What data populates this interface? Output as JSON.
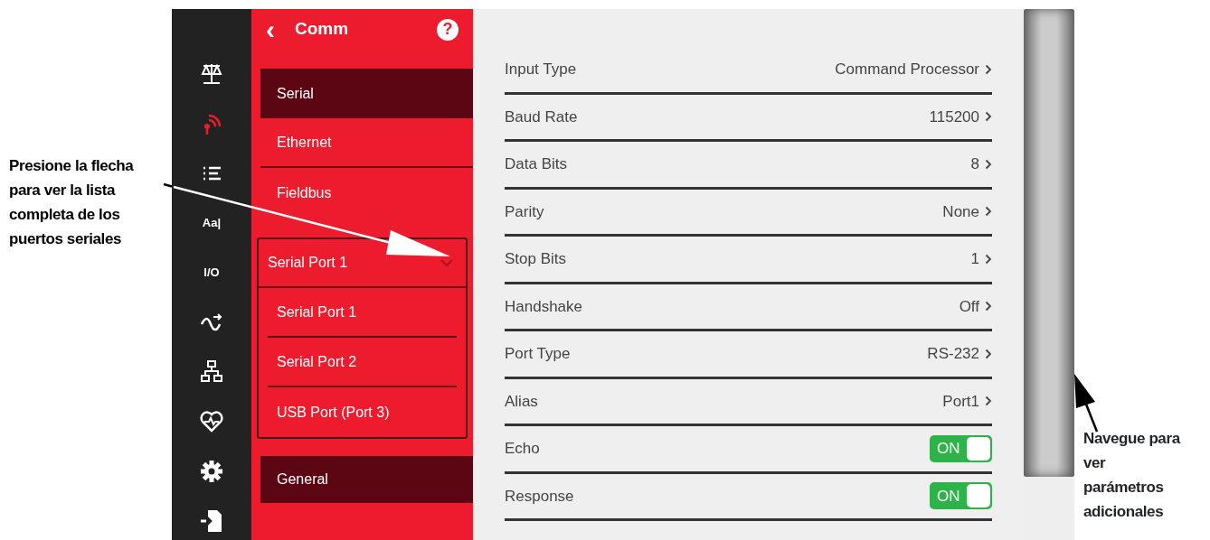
{
  "annotations": [
    {
      "kind": "left",
      "text": "Presione la flecha\npara ver la lista\ncompleta de los\npuertos seriales"
    },
    {
      "kind": "right",
      "text": "Navegue para\nver\nparámetros\nadicionales"
    }
  ],
  "nav_icons": [
    {
      "kind": "scale",
      "selected": false
    },
    {
      "kind": "signal",
      "selected": true
    },
    {
      "kind": "list",
      "selected": false
    },
    {
      "kind": "text",
      "label": "Aa|",
      "selected": false
    },
    {
      "kind": "io",
      "label": "I/O",
      "selected": false
    },
    {
      "kind": "wave",
      "selected": false
    },
    {
      "kind": "network",
      "selected": false
    },
    {
      "kind": "health",
      "selected": false
    },
    {
      "kind": "settings",
      "selected": false
    },
    {
      "kind": "exit",
      "selected": false
    }
  ],
  "panel": {
    "back": "‹",
    "title": "Comm",
    "help": "?",
    "items": [
      {
        "label": "Serial",
        "selected": true
      },
      {
        "label": "Ethernet",
        "selected": false
      },
      {
        "label": "Fieldbus",
        "selected": false
      }
    ],
    "port_select": {
      "value": "Serial Port 1",
      "expanded": true,
      "options": [
        "Serial Port 1",
        "Serial Port 2",
        "USB Port (Port 3)"
      ]
    },
    "footer_items": [
      {
        "label": "General",
        "selected": true
      }
    ]
  },
  "settings": [
    {
      "kind": "select",
      "label": "Input Type",
      "value": "Command Processor"
    },
    {
      "kind": "select",
      "label": "Baud Rate",
      "value": "115200"
    },
    {
      "kind": "select",
      "label": "Data Bits",
      "value": "8"
    },
    {
      "kind": "select",
      "label": "Parity",
      "value": "None"
    },
    {
      "kind": "select",
      "label": "Stop Bits",
      "value": "1"
    },
    {
      "kind": "select",
      "label": "Handshake",
      "value": "Off"
    },
    {
      "kind": "select",
      "label": "Port Type",
      "value": "RS-232"
    },
    {
      "kind": "select",
      "label": "Alias",
      "value": "Port1"
    },
    {
      "kind": "toggle",
      "label": "Echo",
      "on": true,
      "text": "ON"
    },
    {
      "kind": "toggle",
      "label": "Response",
      "on": true,
      "text": "ON"
    }
  ]
}
